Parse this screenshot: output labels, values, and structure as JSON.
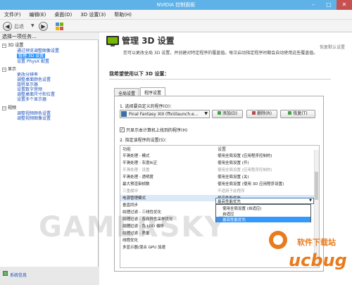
{
  "window": {
    "title": "NVIDIA 控制面板",
    "btn_min": "–",
    "btn_max": "□",
    "btn_close": "✕"
  },
  "menu": [
    "文件(F)",
    "编辑(E)",
    "桌面(D)",
    "3D 设置(3)",
    "帮助(H)"
  ],
  "toolbar": {
    "back_label": "后退",
    "back_icon": "◀",
    "fwd_icon": "▶",
    "dropdown": "▼"
  },
  "sidebar": {
    "header": "选择一项任务...",
    "groups": [
      {
        "label": "3D 设置",
        "items": [
          "通过预览调整图像设置",
          "管理 3D 设置",
          "设置 PhysX 配置"
        ]
      },
      {
        "label": "显示",
        "items": [
          "更改分辨率",
          "调整桌面颜色设置",
          "旋转显示器",
          "设置数字音频",
          "调整桌面尺寸和位置",
          "设置多个显示器"
        ]
      },
      {
        "label": "视频",
        "items": [
          "调整视频颜色设置",
          "调整视频图像设置"
        ]
      }
    ],
    "selected": "管理 3D 设置",
    "system_info": "系统信息"
  },
  "main": {
    "title": "管理 3D 设置",
    "restore_link": "恢复默认设置",
    "description": "您可以更改全局 3D 设置，并创建对特定程序的覆盖值。每次启动指定程序时都会自动使用这些覆盖值。",
    "section": "我希望使用以下 3D 设置：",
    "tabs": [
      "全局设置",
      "程序设置"
    ],
    "active_tab": "程序设置",
    "step1": "1. 选择要自定义的程序(O)：",
    "program": "Final Fantasy XIII (ffxiiilaunch.e...",
    "add_label": "添加(D)",
    "remove_label": "删除(R)",
    "restore_label": "恢复(T)",
    "checkbox_label": "只显示本计算机上找到的程序(H)",
    "checkbox_mark": "✓",
    "step2": "2. 指定该程序的设置(S)：",
    "col_feature": "功能",
    "col_setting": "设置",
    "rows": [
      {
        "feature": "平滑处理 - 模式",
        "setting": "使用全局设置 (应用程序控制的)",
        "dim": false
      },
      {
        "feature": "平滑处理 - 灰度纠正",
        "setting": "使用全局设置 (开)",
        "dim": false
      },
      {
        "feature": "平滑处理 - 设置",
        "setting": "使用全局设置 (应用程序控制的)",
        "dim": true
      },
      {
        "feature": "平滑处理 - 透明度",
        "setting": "使用全局设置 (关)",
        "dim": false
      },
      {
        "feature": "最大预渲染帧数",
        "setting": "使用全局设置 (使用 3D 应用程序设置)",
        "dim": false
      },
      {
        "feature": "三重缓冲",
        "setting": "不适用于此程序",
        "dim": true
      },
      {
        "feature": "电源管理模式",
        "setting": "最高性能优先",
        "dim": false,
        "highlight": true
      },
      {
        "feature": "垂直同步",
        "setting": "",
        "dim": false
      },
      {
        "feature": "纹理过滤 - 三线性优化",
        "setting": "",
        "dim": false
      },
      {
        "feature": "纹理过滤 - 各向异性采样优化",
        "setting": "",
        "dim": false
      },
      {
        "feature": "纹理过滤 - 负 LOD 偏移",
        "setting": "",
        "dim": false
      },
      {
        "feature": "纹理过滤 - 质量",
        "setting": "",
        "dim": false
      },
      {
        "feature": "线程优化",
        "setting": "",
        "dim": false
      },
      {
        "feature": "多显示器/混合 GPU 加速",
        "setting": "",
        "dim": false
      }
    ],
    "combo_value": "最高性能优先",
    "combo_chev": "▼",
    "options": [
      "使用全局设置 (自适应)",
      "自适应",
      "最高性能优先"
    ],
    "selected_option": "最高性能优先"
  },
  "watermark": "GAMERSKY",
  "brand": {
    "logo_text": "ucbug",
    "sub_text": "软件下载站"
  }
}
